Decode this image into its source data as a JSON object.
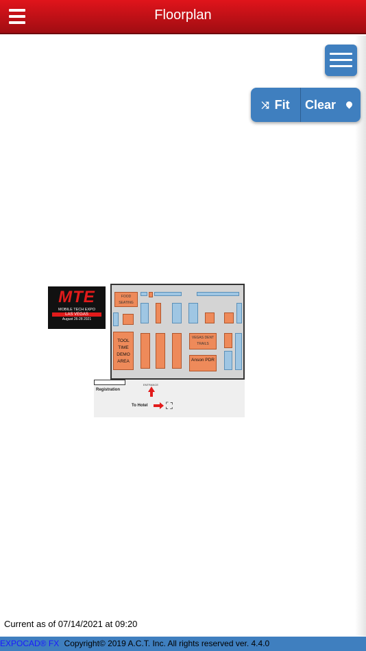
{
  "header": {
    "title": "Floorplan"
  },
  "toolbar": {
    "fit_label": "Fit",
    "clear_label": "Clear"
  },
  "floorplan": {
    "logo": {
      "title": "MTE",
      "line1": "MOBILE TECH EXPO",
      "line2": "LAS VEGAS",
      "line3": "August 26-28 2021"
    },
    "areas": {
      "food": "FOOD SEATING",
      "tool": "TOOL TIME DEMO AREA",
      "vegas": "VEGAS DENT TRAILS",
      "anson": "Anson PDR"
    },
    "registration": "Registration",
    "entrance": "ENTRANCE",
    "hotel": "To Hotel"
  },
  "status": {
    "text": "Current as of 07/14/2021 at 09:20"
  },
  "footer": {
    "brand": "EXPOCAD® FX",
    "copyright": "Copyright© 2019 A.C.T. Inc. All rights reserved  ver. 4.4.0"
  },
  "colors": {
    "header": "#c4111a",
    "accent": "#3f7fbf",
    "booth": "#ee8a5a",
    "booth_blue": "#9fc6e3"
  }
}
